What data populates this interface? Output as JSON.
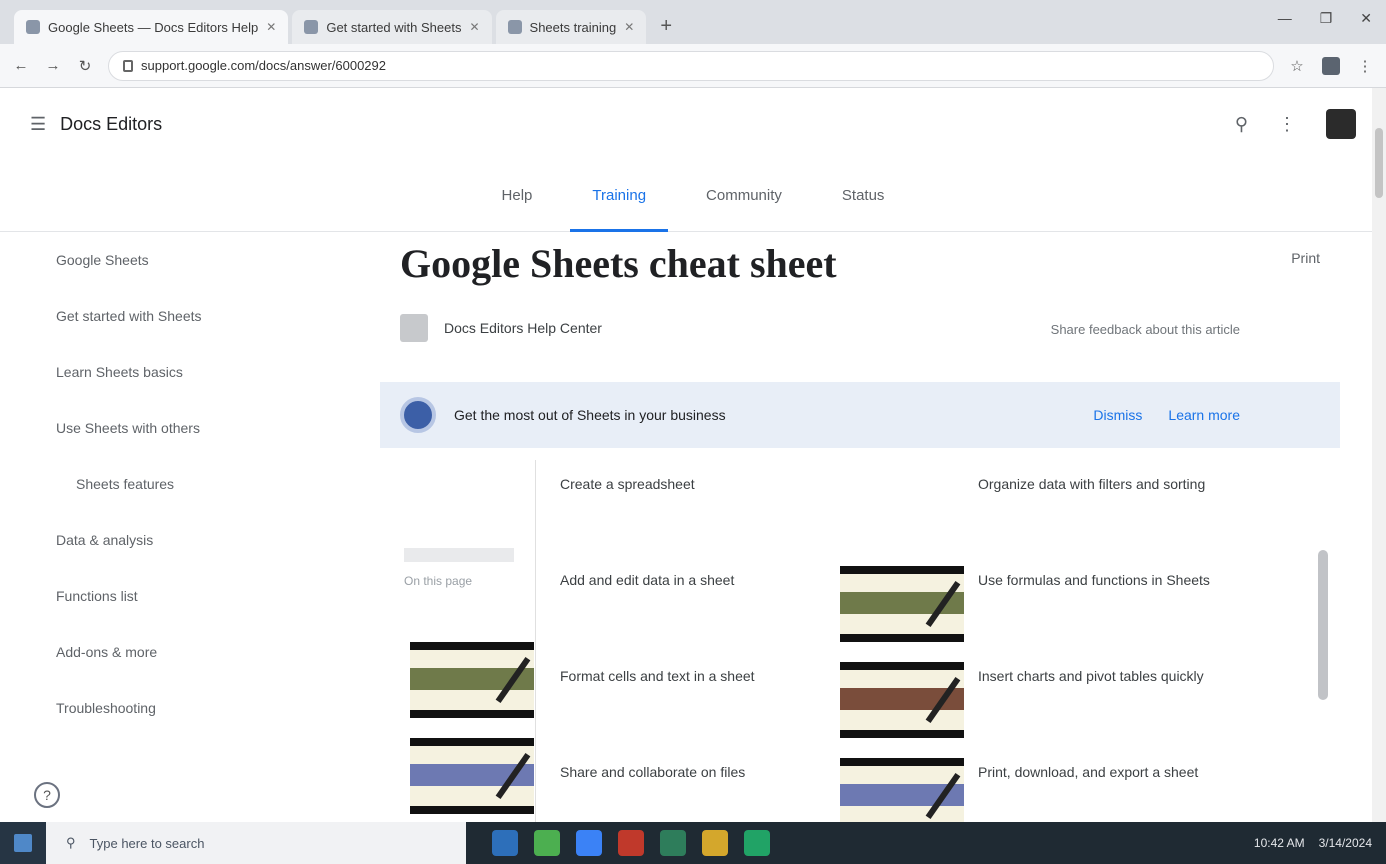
{
  "browser": {
    "tabs": [
      {
        "title": "Google Sheets — Docs Editors Help",
        "active": true
      },
      {
        "title": "Get started with Sheets",
        "active": false
      },
      {
        "title": "Sheets training",
        "active": false
      }
    ],
    "url": "support.google.com/docs/answer/6000292",
    "window_controls": [
      "—",
      "❐",
      "✕"
    ]
  },
  "header": {
    "brand": "Docs Editors",
    "tabs": [
      "Help",
      "Training",
      "Community",
      "Status"
    ]
  },
  "leftnav": {
    "items": [
      {
        "label": "Google Sheets",
        "indent": false
      },
      {
        "label": "Get started with Sheets",
        "indent": false
      },
      {
        "label": "Learn Sheets basics",
        "indent": false
      },
      {
        "label": "Use Sheets with others",
        "indent": false
      },
      {
        "label": "Sheets features",
        "indent": true
      },
      {
        "label": "Data & analysis",
        "indent": false
      },
      {
        "label": "Functions list",
        "indent": false
      },
      {
        "label": "Add-ons & more",
        "indent": false
      },
      {
        "label": "Troubleshooting",
        "indent": false
      }
    ],
    "help_label": "?"
  },
  "main": {
    "title": "Google Sheets cheat sheet",
    "title_link": "Print",
    "author": "Docs Editors Help Center",
    "updated": "Share feedback about this article",
    "banner": {
      "text": "Get the most out of Sheets in your business",
      "actions": [
        "Dismiss",
        "Learn more"
      ]
    },
    "gallery_label": "On this page",
    "column1": [
      "Create a spreadsheet",
      "Add and edit data in a sheet",
      "Format cells and text in a sheet",
      "Share and collaborate on files"
    ],
    "column2": [
      "Organize data with filters and sorting",
      "Use formulas and functions in Sheets",
      "Insert charts and pivot tables quickly",
      "Print, download, and export a sheet"
    ]
  },
  "taskbar": {
    "search": "Type here to search",
    "time": "10:42 AM",
    "date": "3/14/2024",
    "icon_colors": [
      "#2d6fba",
      "#4caf50",
      "#3b82f6",
      "#c0392b",
      "#2e7d5b",
      "#d4a72c",
      "#21a366"
    ]
  }
}
